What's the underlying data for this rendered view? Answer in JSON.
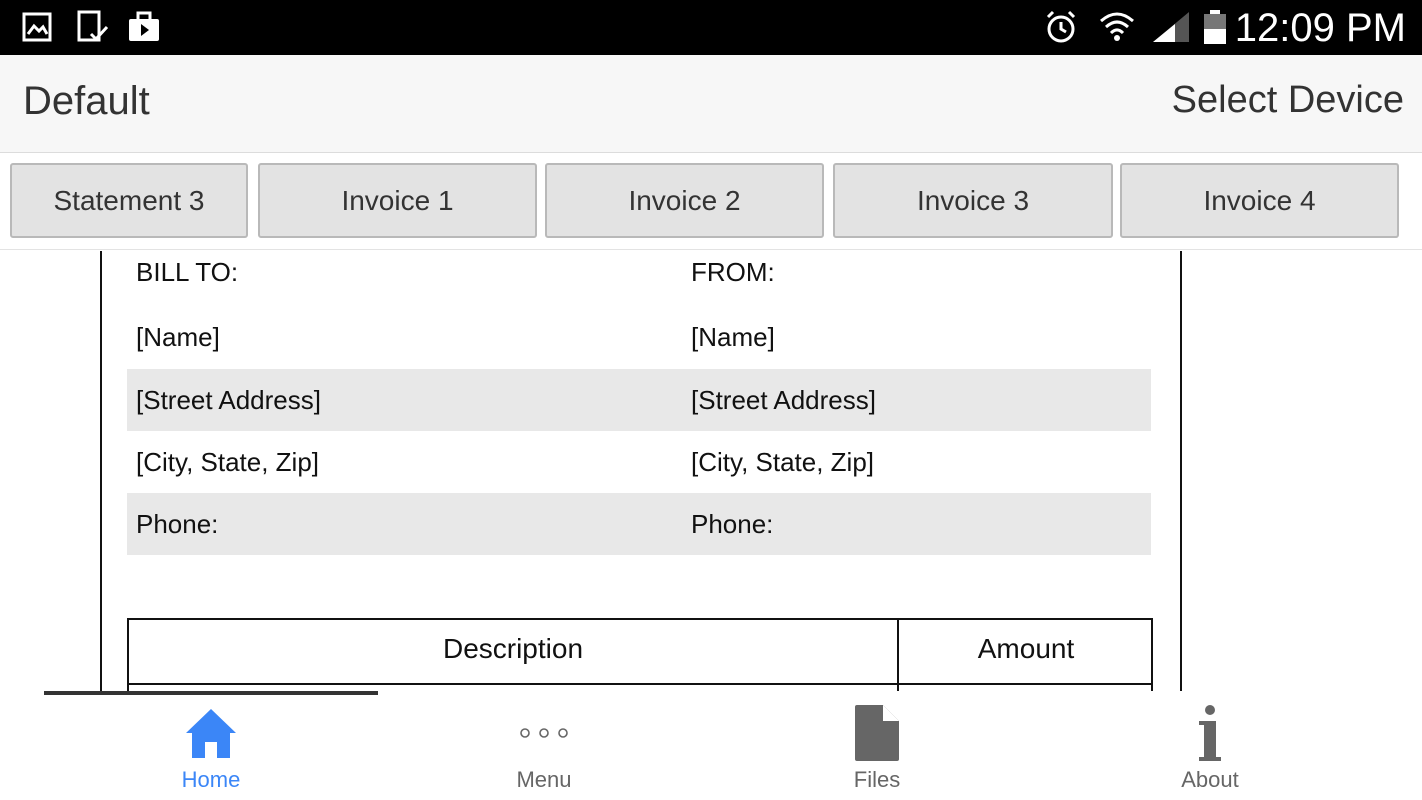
{
  "status_bar": {
    "time": "12:09 PM",
    "left_icons": [
      "gallery-icon",
      "device-check-icon",
      "briefcase-icon"
    ],
    "right_icons": [
      "alarm-icon",
      "wifi-icon",
      "signal-icon",
      "battery-icon"
    ]
  },
  "header": {
    "title": "Default",
    "action": "Select Device"
  },
  "tabs": [
    {
      "label": "Statement 3"
    },
    {
      "label": "Invoice 1"
    },
    {
      "label": "Invoice 2"
    },
    {
      "label": "Invoice 3"
    },
    {
      "label": "Invoice 4"
    }
  ],
  "document": {
    "bill_to_label": "BILL TO:",
    "from_label": "FROM:",
    "rows": [
      {
        "left": "[Name]",
        "right": "[Name]"
      },
      {
        "left": "[Street Address]",
        "right": "[Street Address]"
      },
      {
        "left": "[City, State, Zip]",
        "right": "[City, State, Zip]"
      },
      {
        "left": "Phone:",
        "right": "Phone:"
      }
    ],
    "table_headers": {
      "description": "Description",
      "amount": "Amount"
    }
  },
  "bottom_nav": {
    "items": [
      {
        "label": "Home",
        "icon": "home-icon",
        "active": true
      },
      {
        "label": "Menu",
        "icon": "more-dots-icon",
        "active": false
      },
      {
        "label": "Files",
        "icon": "file-icon",
        "active": false
      },
      {
        "label": "About",
        "icon": "info-icon",
        "active": false
      }
    ]
  },
  "colors": {
    "accent": "#3b86f7",
    "status_bar": "#000000",
    "tab_bg": "#e3e3e3",
    "row_shade": "#e8e8e8"
  }
}
